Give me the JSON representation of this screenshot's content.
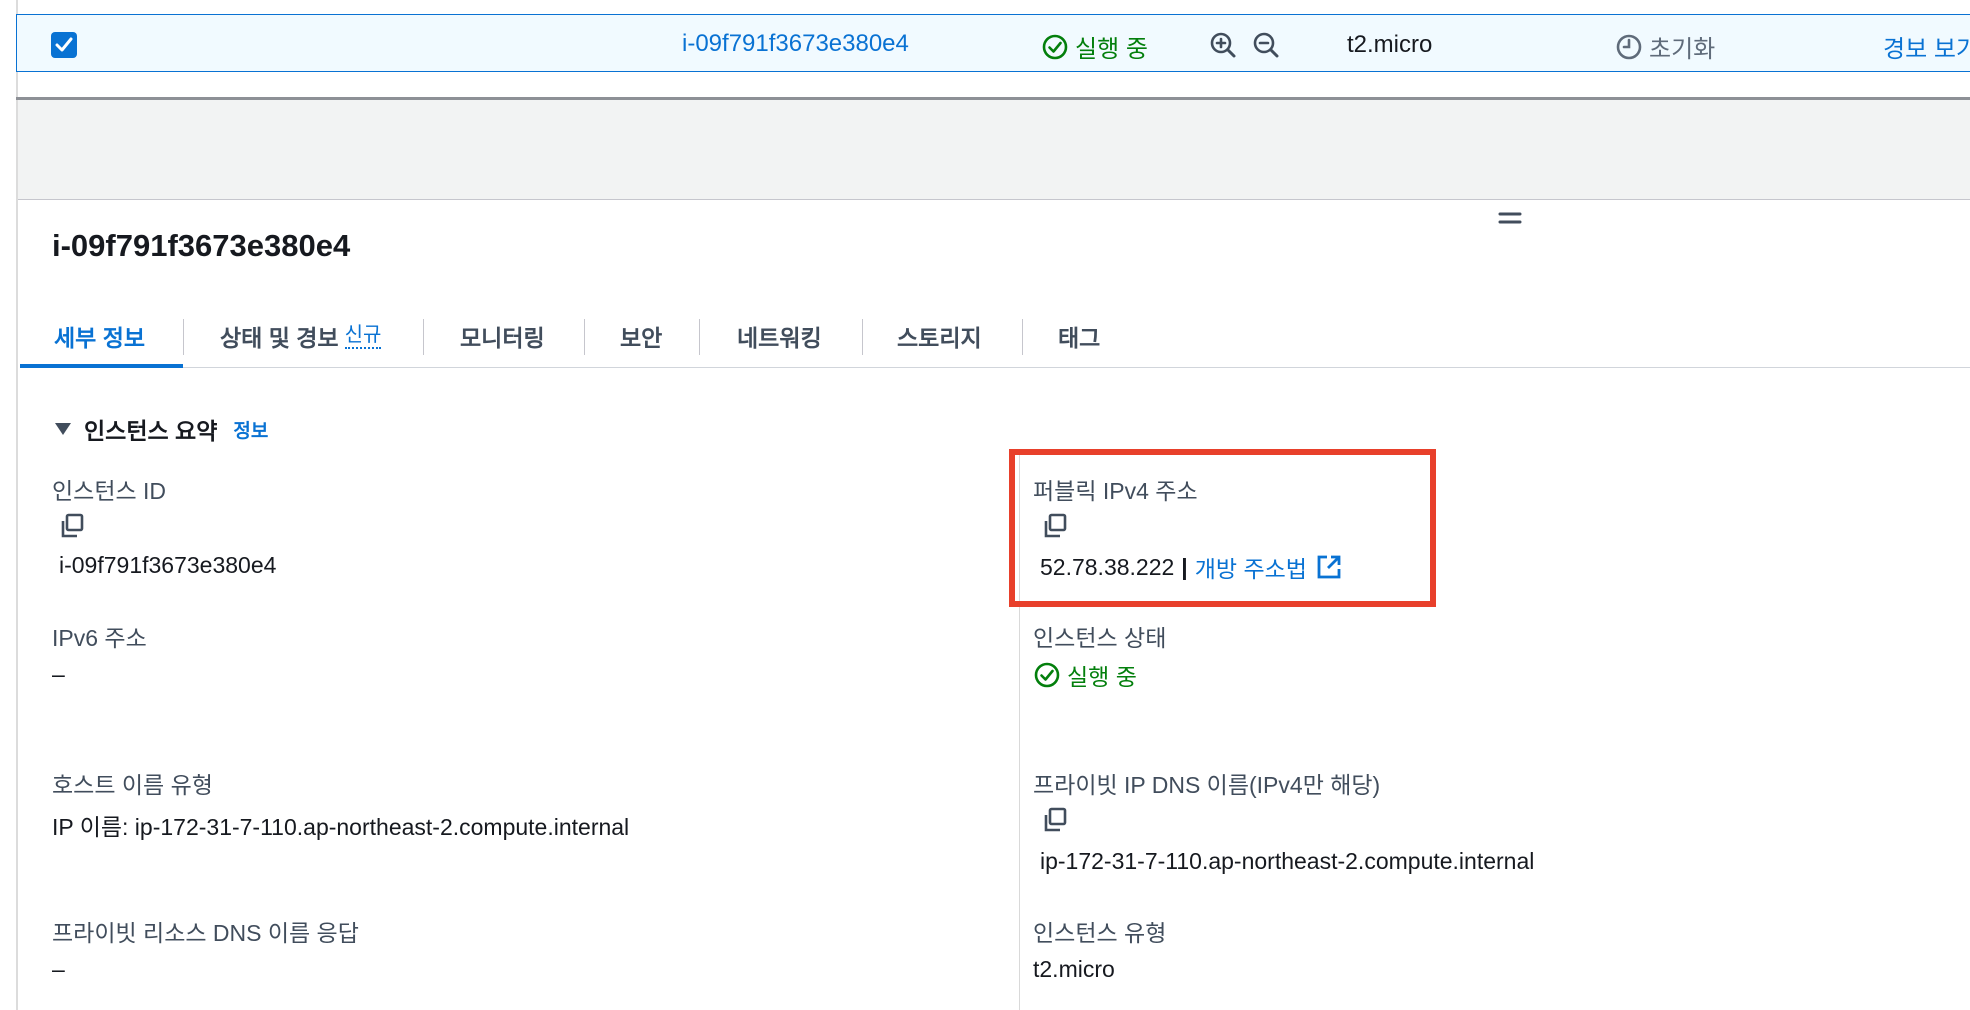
{
  "table_row": {
    "instance_id": "i-09f791f3673e380e4",
    "state": "실행 중",
    "instance_type": "t2.micro",
    "status_check": "초기화",
    "alarm_link": "경보 보기"
  },
  "detail": {
    "title": "i-09f791f3673e380e4",
    "tabs": [
      {
        "label": "세부 정보",
        "active": true
      },
      {
        "label": "상태 및 경보",
        "badge": "신규"
      },
      {
        "label": "모니터링"
      },
      {
        "label": "보안"
      },
      {
        "label": "네트워킹"
      },
      {
        "label": "스토리지"
      },
      {
        "label": "태그"
      }
    ],
    "section": {
      "title": "인스턴스 요약",
      "info_link": "정보"
    },
    "fields": {
      "instance_id": {
        "label": "인스턴스 ID",
        "value": "i-09f791f3673e380e4"
      },
      "public_ipv4": {
        "label": "퍼블릭 IPv4 주소",
        "value": "52.78.38.222",
        "separator": "|",
        "link": "개방 주소법"
      },
      "ipv6": {
        "label": "IPv6 주소",
        "value": "–"
      },
      "instance_state": {
        "label": "인스턴스 상태",
        "value": "실행 중"
      },
      "hostname_type": {
        "label": "호스트 이름 유형",
        "value": "IP 이름: ip-172-31-7-110.ap-northeast-2.compute.internal"
      },
      "private_ip_dns": {
        "label": "프라이빗 IP DNS 이름(IPv4만 해당)",
        "value": "ip-172-31-7-110.ap-northeast-2.compute.internal"
      },
      "private_resource_dns": {
        "label": "프라이빗 리소스 DNS 이름 응답",
        "value": "–"
      },
      "instance_type": {
        "label": "인스턴스 유형",
        "value": "t2.micro"
      }
    }
  },
  "colors": {
    "link": "#0972d3",
    "success": "#037f0c",
    "highlight": "#e8402b"
  }
}
